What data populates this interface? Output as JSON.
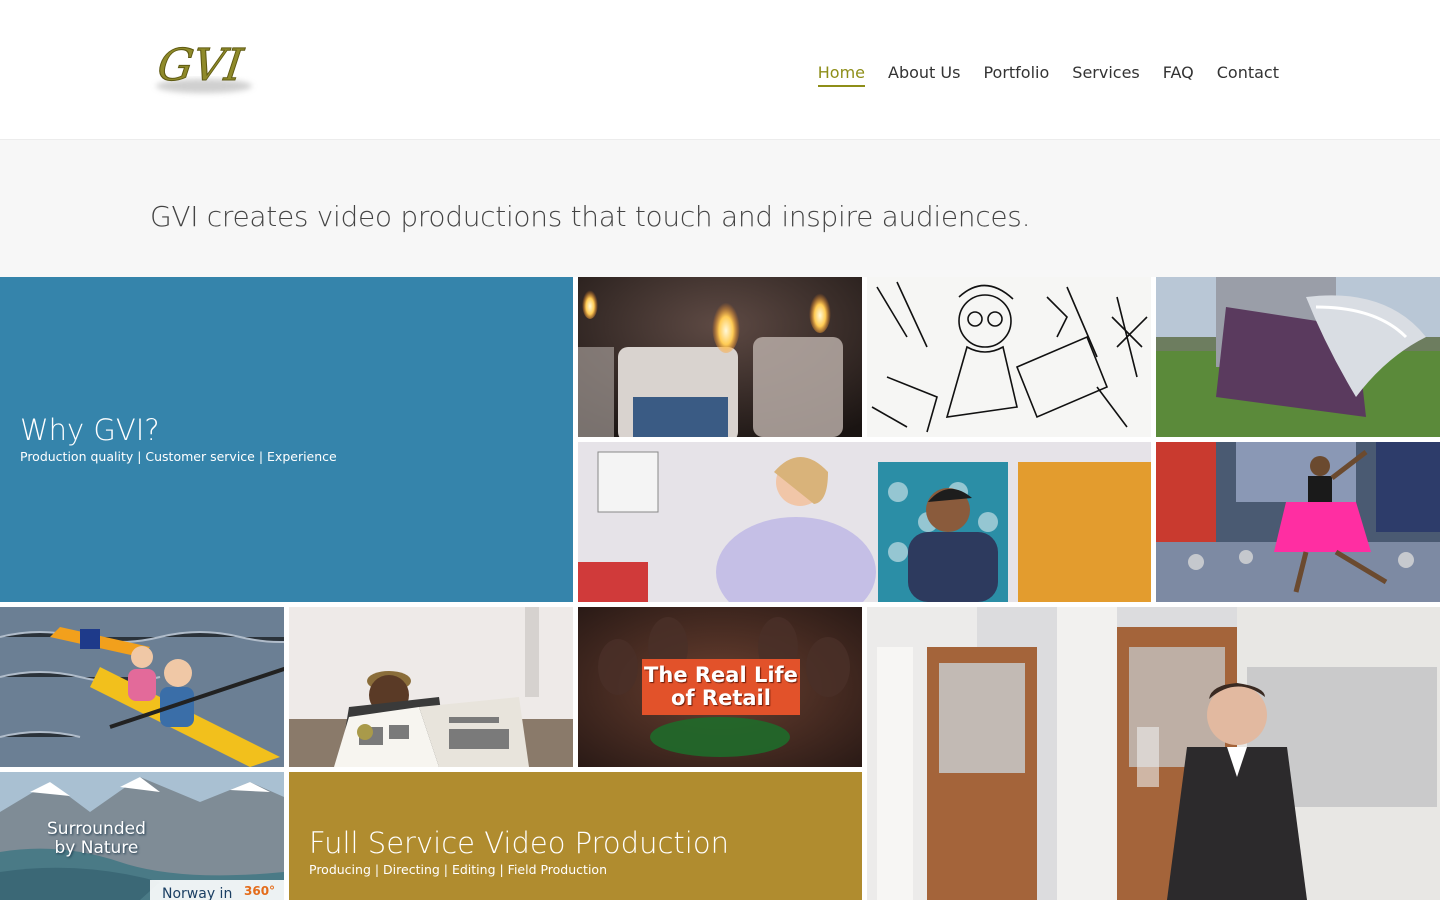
{
  "header": {
    "logo_text": "GVI",
    "nav": [
      {
        "label": "Home",
        "active": true
      },
      {
        "label": "About Us",
        "active": false
      },
      {
        "label": "Portfolio",
        "active": false
      },
      {
        "label": "Services",
        "active": false
      },
      {
        "label": "FAQ",
        "active": false
      },
      {
        "label": "Contact",
        "active": false
      }
    ]
  },
  "tagline": "GVI creates video productions that touch and inspire audiences.",
  "tiles": {
    "why": {
      "title": "Why GVI?",
      "subtitle": "Production quality | Customer service | Experience"
    },
    "full_service": {
      "title": "Full Service Video Production",
      "subtitle": "Producing | Directing | Editing | Field Production"
    },
    "retail": {
      "line1": "The Real Life",
      "line2": "of Retail"
    },
    "norway": {
      "line1": "Surrounded",
      "line2": "by Nature",
      "sub": "Norway in",
      "badge": "360°"
    }
  },
  "colors": {
    "accent_nav": "#8e8e18",
    "why_tile": "#3584ab",
    "full_service_tile": "#b08c2f",
    "logo_gold": "#8f8a2a"
  }
}
